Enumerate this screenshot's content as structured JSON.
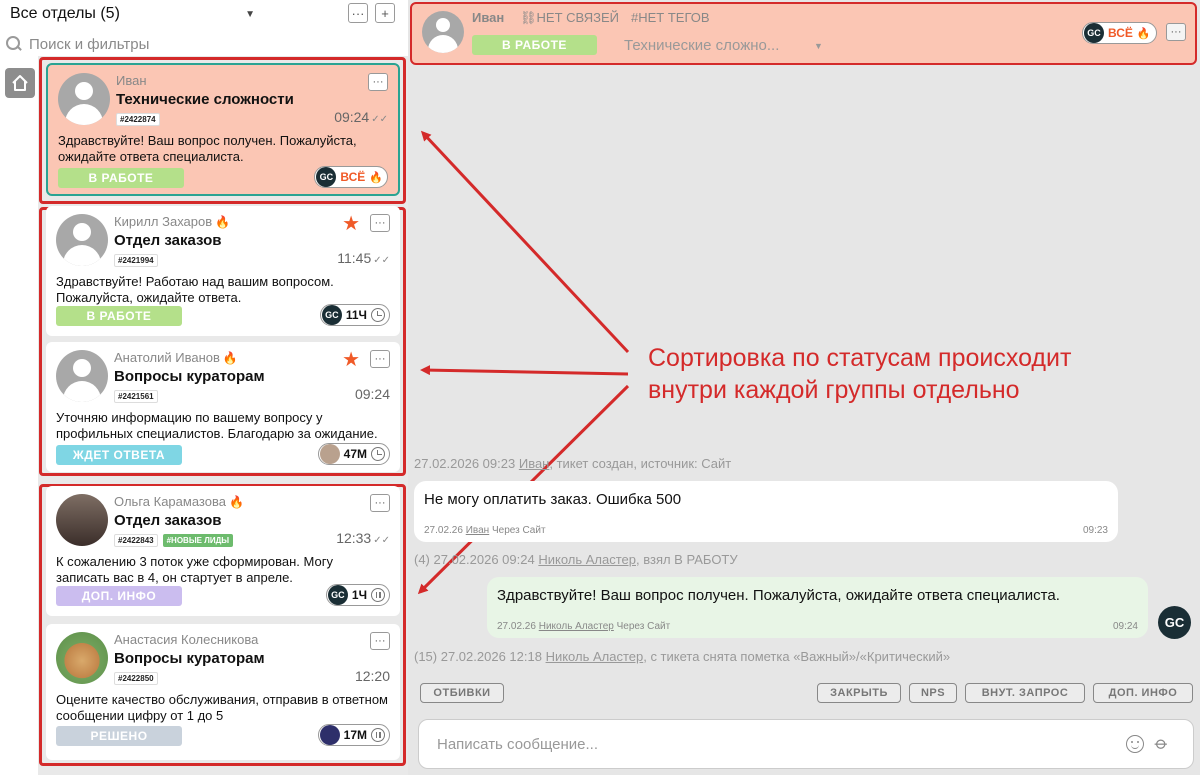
{
  "sidebar": {
    "department_selector": "Все отделы (5)",
    "search_placeholder": "Поиск и фильтры",
    "more_label": "···",
    "add_label": "+"
  },
  "tickets": [
    {
      "name": "Иван",
      "hot": false,
      "starred": false,
      "title": "Технические сложности",
      "tags": [
        "#2422874"
      ],
      "time": "09:24",
      "read": true,
      "message": "Здравствуйте! Ваш вопрос получен. Пожалуйста, ожидайте ответа специалиста.",
      "status": "В РАБОТЕ",
      "pill_label": "ВСЁ",
      "pill_icon": "fire-icon",
      "active": true
    },
    {
      "name": "Кирилл Захаров",
      "hot": true,
      "starred": true,
      "title": "Отдел заказов",
      "tags": [
        "#2421994"
      ],
      "time": "11:45",
      "read": true,
      "message": "Здравствуйте! Работаю над вашим вопросом. Пожалуйста, ожидайте ответа.",
      "status": "В РАБОТЕ",
      "pill_label": "11Ч",
      "pill_icon": "clock-icon"
    },
    {
      "name": "Анатолий Иванов",
      "hot": true,
      "starred": true,
      "title": "Вопросы кураторам",
      "tags": [
        "#2421561"
      ],
      "time": "09:24",
      "read": false,
      "message": "Уточняю информацию по вашему вопросу у профильных специалистов. Благодарю за ожидание.",
      "status": "ЖДЕТ ОТВЕТА",
      "pill_label": "47М",
      "pill_icon": "clock-icon"
    },
    {
      "name": "Ольга Карамазова",
      "hot": true,
      "starred": false,
      "title": "Отдел заказов",
      "tags": [
        "#2422843",
        "#НОВЫЕ ЛИДЫ"
      ],
      "time": "12:33",
      "read": true,
      "message": "К сожалению 3 поток уже сформирован. Могу записать вас в 4, он стартует в апреле.",
      "status": "ДОП. ИНФО",
      "pill_label": "1Ч",
      "pill_icon": "pause-icon"
    },
    {
      "name": "Анастасия Колесникова",
      "hot": false,
      "starred": false,
      "title": "Вопросы кураторам",
      "tags": [
        "#2422850"
      ],
      "time": "12:20",
      "read": false,
      "message": "Оцените качество обслуживания, отправив в ответном сообщении цифру от 1 до 5",
      "status": "РЕШЕНО",
      "pill_label": "17М",
      "pill_icon": "pause-icon"
    }
  ],
  "chat_header": {
    "name": "Иван",
    "links": "НЕТ СВЯЗЕЙ",
    "tags": "#НЕТ ТЕГОВ",
    "status": "В РАБОТЕ",
    "topic": "Технические сложно...",
    "pill_label": "ВСЁ",
    "avatar_text": "GC"
  },
  "annotation": {
    "line1": "Сортировка по статусам происходит",
    "line2": "внутри каждой группы отдельно"
  },
  "messages": {
    "sys1_prefix": "27.02.2026 09:23",
    "sys1_user": "Иван",
    "sys1_suffix": ", тикет создан, источник: Сайт",
    "m1_text": "Не могу оплатить заказ. Ошибка 500",
    "m1_date": "27.02.26",
    "m1_user": "Иван",
    "m1_via": "Через Сайт",
    "m1_time": "09:23",
    "sys2_prefix": "(4)  27.02.2026 09:24",
    "sys2_user": "Николь Аластер",
    "sys2_suffix": ", взял В РАБОТУ",
    "m2_text": "Здравствуйте! Ваш вопрос получен. Пожалуйста, ожидайте ответа специалиста.",
    "m2_date": "27.02.26",
    "m2_user": "Николь Аластер",
    "m2_via": "Через Сайт",
    "m2_time": "09:24",
    "sys3_prefix": "(15)  27.02.2026 12:18",
    "sys3_user": "Николь Аластер",
    "sys3_suffix": ", с тикета снята пометка «Важный»/«Критический»",
    "operator_avatar": "GC"
  },
  "quick_buttons": {
    "templates": "ОТБИВКИ",
    "close": "ЗАКРЫТЬ",
    "nps": "NPS",
    "internal": "ВНУТ. ЗАПРОС",
    "more_info": "ДОП. ИНФО"
  },
  "composer": {
    "placeholder": "Написать сообщение..."
  },
  "colors": {
    "highlight_red": "#d42a2a",
    "active_ticket_bg": "#fbc6b4",
    "status_in_work": "#b4e08a",
    "status_waiting": "#7fd6e4",
    "status_more_info": "#cbbdef",
    "status_solved": "#c9d2dc"
  }
}
